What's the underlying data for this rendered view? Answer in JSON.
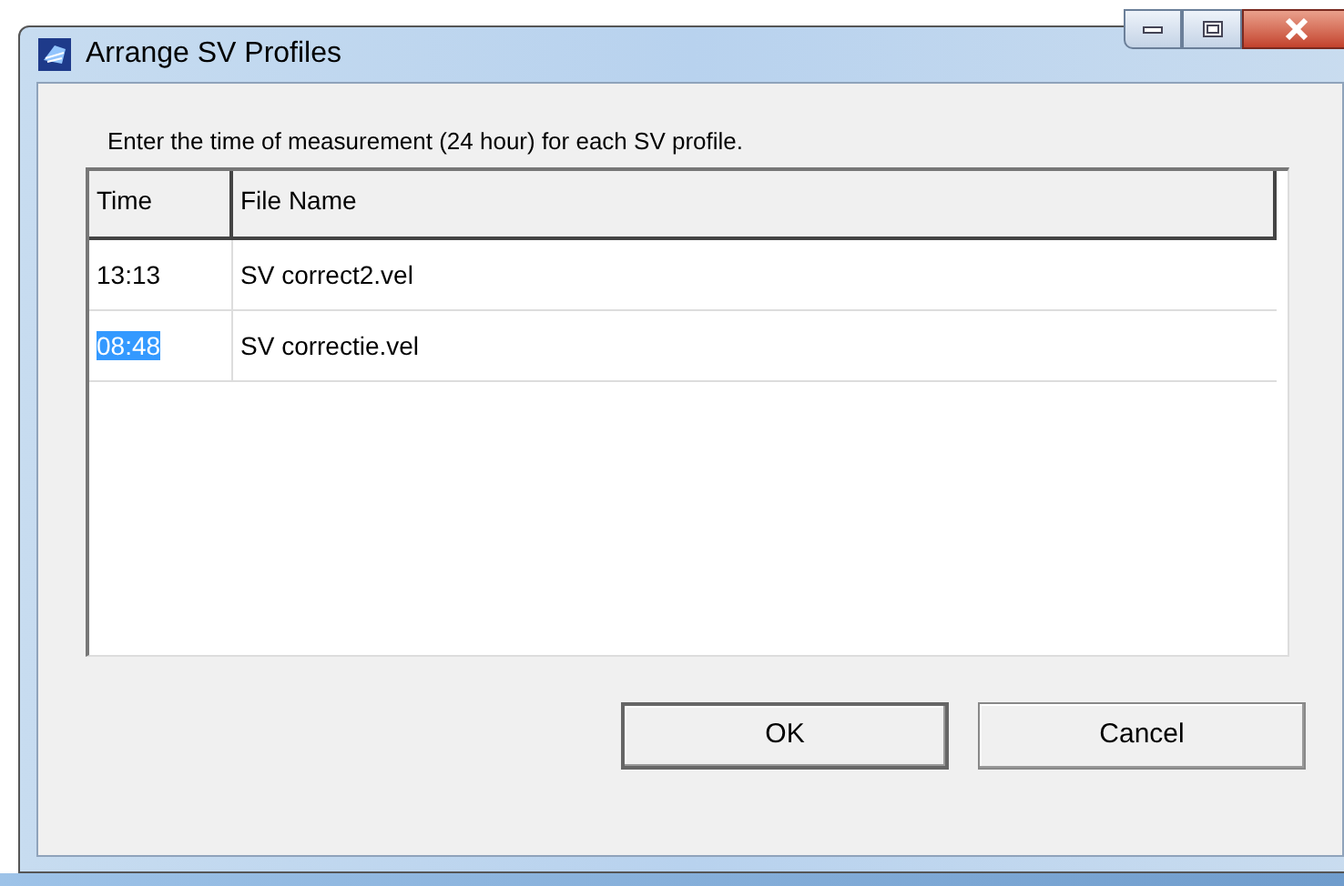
{
  "window": {
    "title": "Arrange SV Profiles"
  },
  "instruction": "Enter the time of measurement (24 hour) for each SV profile.",
  "table": {
    "columns": [
      "Time",
      "File Name"
    ],
    "rows": [
      {
        "time": "13:13",
        "file_name": "SV correct2.vel",
        "selected": false
      },
      {
        "time": "08:48",
        "file_name": "SV correctie.vel",
        "selected": true
      }
    ]
  },
  "buttons": [
    "OK",
    "Cancel"
  ]
}
